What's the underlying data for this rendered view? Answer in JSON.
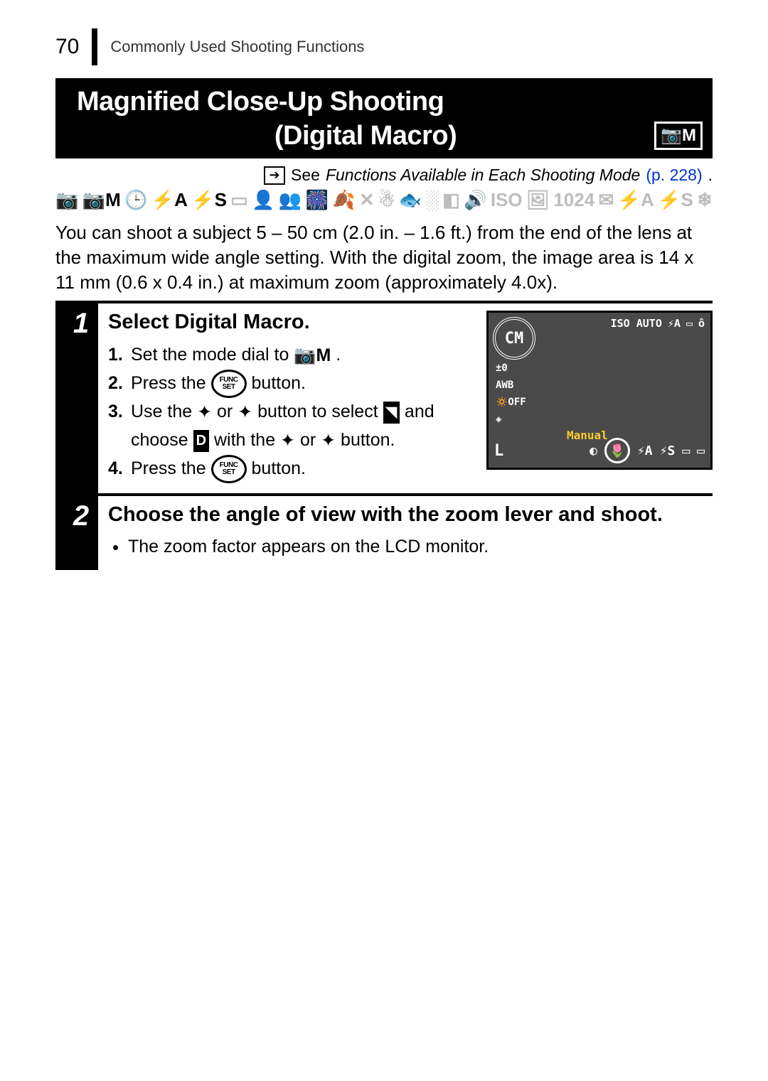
{
  "page_number": "70",
  "breadcrumb": "Commonly Used Shooting Functions",
  "title_line1": "Magnified Close-Up Shooting",
  "title_line2": "(Digital Macro)",
  "title_icon_label": "📷M",
  "see_also": {
    "prefix": "See",
    "text": "Functions Available in Each Shooting Mode",
    "page_ref": "(p. 228)",
    "period": "."
  },
  "mode_icons": {
    "active": [
      "📷",
      "📷M",
      "🕒",
      "⚡A",
      "⚡S"
    ],
    "inactive": [
      "▭",
      "👤",
      "👥",
      "🎆",
      "🍂",
      "✕",
      "☃",
      "🐟",
      "░",
      "◧",
      "🔊",
      "ISO",
      "🖼",
      "1024",
      "✉",
      "⚡A",
      "⚡S",
      "❄"
    ]
  },
  "intro": "You can shoot a subject 5 – 50 cm (2.0 in. – 1.6 ft.) from the end of the lens at the maximum wide angle setting. With the digital zoom, the image area is 14 x 11 mm (0.6 x 0.4 in.) at maximum zoom (approximately 4.0x).",
  "steps": [
    {
      "num": "1",
      "heading": "Select Digital Macro.",
      "items": [
        {
          "n": "1.",
          "pre": "Set the mode dial to ",
          "icon": "📷M",
          "post": " ."
        },
        {
          "n": "2.",
          "pre": "Press the ",
          "icon": "FUNC/SET",
          "post": " button."
        },
        {
          "n": "3.",
          "pre": "Use the ",
          "icon": "↑",
          "mid1": " or ",
          "icon2": "↓",
          "mid2": " button to select ",
          "icon3": "digital-macro",
          "mid3": " and choose ",
          "icon4": "D-box",
          "mid4": " with the ",
          "icon5": "←",
          "mid5": " or ",
          "icon6": "→",
          "post": " button."
        },
        {
          "n": "4.",
          "pre": "Press the ",
          "icon": "FUNC/SET",
          "post": " button."
        }
      ],
      "lcd": {
        "selected": "CM",
        "top_right": [
          "ISO AUTO",
          "⚡A",
          "▭",
          "ô"
        ],
        "left_col": [
          "±0",
          "AWB",
          "🔅OFF",
          "◈"
        ],
        "manual_label": "Manual",
        "bottom": {
          "L": "L",
          "off": "◐",
          "circ": "🌷",
          "a": "⚡A",
          "s": "⚡S",
          "c1": "▭",
          "c2": "▭"
        }
      }
    },
    {
      "num": "2",
      "heading": "Choose the angle of view with the zoom lever and shoot.",
      "bullets": [
        "The zoom factor appears on the LCD monitor."
      ]
    }
  ]
}
